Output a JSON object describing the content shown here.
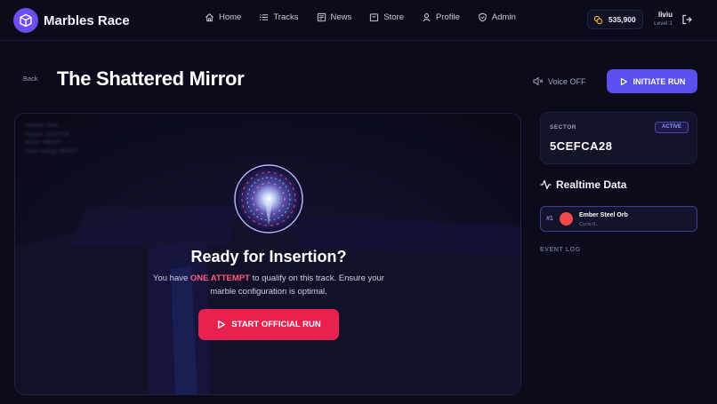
{
  "app": {
    "name": "Marbles Race"
  },
  "nav": [
    {
      "label": "Home",
      "icon": "home-icon"
    },
    {
      "label": "Tracks",
      "icon": "list-icon"
    },
    {
      "label": "News",
      "icon": "newspaper-icon"
    },
    {
      "label": "Store",
      "icon": "store-icon"
    },
    {
      "label": "Profile",
      "icon": "user-icon"
    },
    {
      "label": "Admin",
      "icon": "shield-icon"
    }
  ],
  "balance": {
    "amount": "535,900",
    "icon": "coins-icon"
  },
  "user": {
    "name": "liviu",
    "level": "Level 1"
  },
  "page": {
    "back_label": "Back",
    "title": "The Shattered Mirror",
    "voice_label": "Voice OFF",
    "initiate_label": "INITIATE RUN"
  },
  "game": {
    "stats": [
      "Position: WAIT",
      "Players: 1/ACTIVE",
      "Sector: READY",
      "Track Energy: READY"
    ],
    "ready_title": "Ready for Insertion?",
    "desc_prefix": "You have ",
    "desc_highlight": "ONE ATTEMPT",
    "desc_suffix": " to qualify on this track. Ensure your marble configuration is optimal.",
    "start_label": "START OFFICIAL RUN"
  },
  "sector": {
    "label": "SECTOR",
    "code": "5CEFCA28",
    "status": "ACTIVE"
  },
  "realtime": {
    "title": "Realtime Data",
    "entries": [
      {
        "rank": "#1",
        "name": "Ember Steel Orb",
        "sub": "Cycle 0...",
        "color": "#ef4a4a"
      }
    ]
  },
  "event_log": {
    "title": "EVENT LOG"
  },
  "colors": {
    "accent": "#5b4ff0",
    "danger": "#e8214e",
    "highlight": "#ff5b7d",
    "background": "#0b0b1c"
  }
}
